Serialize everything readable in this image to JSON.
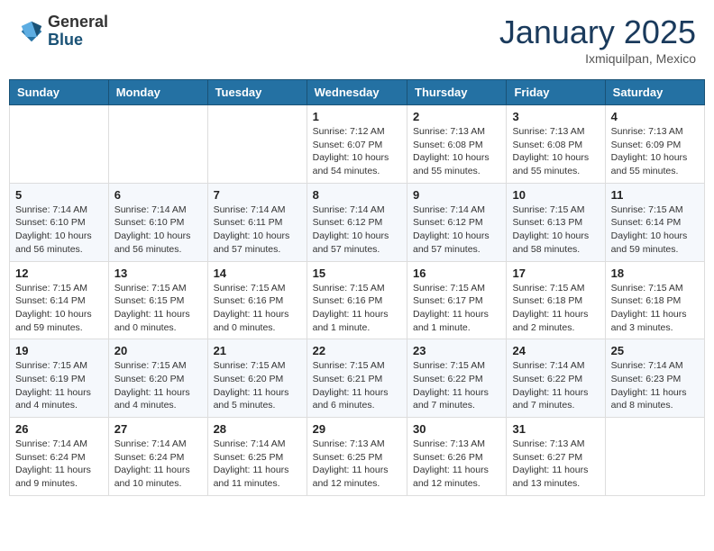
{
  "header": {
    "logo_general": "General",
    "logo_blue": "Blue",
    "month_title": "January 2025",
    "location": "Ixmiquilpan, Mexico"
  },
  "days_of_week": [
    "Sunday",
    "Monday",
    "Tuesday",
    "Wednesday",
    "Thursday",
    "Friday",
    "Saturday"
  ],
  "weeks": [
    [
      {
        "day": "",
        "info": ""
      },
      {
        "day": "",
        "info": ""
      },
      {
        "day": "",
        "info": ""
      },
      {
        "day": "1",
        "info": "Sunrise: 7:12 AM\nSunset: 6:07 PM\nDaylight: 10 hours\nand 54 minutes."
      },
      {
        "day": "2",
        "info": "Sunrise: 7:13 AM\nSunset: 6:08 PM\nDaylight: 10 hours\nand 55 minutes."
      },
      {
        "day": "3",
        "info": "Sunrise: 7:13 AM\nSunset: 6:08 PM\nDaylight: 10 hours\nand 55 minutes."
      },
      {
        "day": "4",
        "info": "Sunrise: 7:13 AM\nSunset: 6:09 PM\nDaylight: 10 hours\nand 55 minutes."
      }
    ],
    [
      {
        "day": "5",
        "info": "Sunrise: 7:14 AM\nSunset: 6:10 PM\nDaylight: 10 hours\nand 56 minutes."
      },
      {
        "day": "6",
        "info": "Sunrise: 7:14 AM\nSunset: 6:10 PM\nDaylight: 10 hours\nand 56 minutes."
      },
      {
        "day": "7",
        "info": "Sunrise: 7:14 AM\nSunset: 6:11 PM\nDaylight: 10 hours\nand 57 minutes."
      },
      {
        "day": "8",
        "info": "Sunrise: 7:14 AM\nSunset: 6:12 PM\nDaylight: 10 hours\nand 57 minutes."
      },
      {
        "day": "9",
        "info": "Sunrise: 7:14 AM\nSunset: 6:12 PM\nDaylight: 10 hours\nand 57 minutes."
      },
      {
        "day": "10",
        "info": "Sunrise: 7:15 AM\nSunset: 6:13 PM\nDaylight: 10 hours\nand 58 minutes."
      },
      {
        "day": "11",
        "info": "Sunrise: 7:15 AM\nSunset: 6:14 PM\nDaylight: 10 hours\nand 59 minutes."
      }
    ],
    [
      {
        "day": "12",
        "info": "Sunrise: 7:15 AM\nSunset: 6:14 PM\nDaylight: 10 hours\nand 59 minutes."
      },
      {
        "day": "13",
        "info": "Sunrise: 7:15 AM\nSunset: 6:15 PM\nDaylight: 11 hours\nand 0 minutes."
      },
      {
        "day": "14",
        "info": "Sunrise: 7:15 AM\nSunset: 6:16 PM\nDaylight: 11 hours\nand 0 minutes."
      },
      {
        "day": "15",
        "info": "Sunrise: 7:15 AM\nSunset: 6:16 PM\nDaylight: 11 hours\nand 1 minute."
      },
      {
        "day": "16",
        "info": "Sunrise: 7:15 AM\nSunset: 6:17 PM\nDaylight: 11 hours\nand 1 minute."
      },
      {
        "day": "17",
        "info": "Sunrise: 7:15 AM\nSunset: 6:18 PM\nDaylight: 11 hours\nand 2 minutes."
      },
      {
        "day": "18",
        "info": "Sunrise: 7:15 AM\nSunset: 6:18 PM\nDaylight: 11 hours\nand 3 minutes."
      }
    ],
    [
      {
        "day": "19",
        "info": "Sunrise: 7:15 AM\nSunset: 6:19 PM\nDaylight: 11 hours\nand 4 minutes."
      },
      {
        "day": "20",
        "info": "Sunrise: 7:15 AM\nSunset: 6:20 PM\nDaylight: 11 hours\nand 4 minutes."
      },
      {
        "day": "21",
        "info": "Sunrise: 7:15 AM\nSunset: 6:20 PM\nDaylight: 11 hours\nand 5 minutes."
      },
      {
        "day": "22",
        "info": "Sunrise: 7:15 AM\nSunset: 6:21 PM\nDaylight: 11 hours\nand 6 minutes."
      },
      {
        "day": "23",
        "info": "Sunrise: 7:15 AM\nSunset: 6:22 PM\nDaylight: 11 hours\nand 7 minutes."
      },
      {
        "day": "24",
        "info": "Sunrise: 7:14 AM\nSunset: 6:22 PM\nDaylight: 11 hours\nand 7 minutes."
      },
      {
        "day": "25",
        "info": "Sunrise: 7:14 AM\nSunset: 6:23 PM\nDaylight: 11 hours\nand 8 minutes."
      }
    ],
    [
      {
        "day": "26",
        "info": "Sunrise: 7:14 AM\nSunset: 6:24 PM\nDaylight: 11 hours\nand 9 minutes."
      },
      {
        "day": "27",
        "info": "Sunrise: 7:14 AM\nSunset: 6:24 PM\nDaylight: 11 hours\nand 10 minutes."
      },
      {
        "day": "28",
        "info": "Sunrise: 7:14 AM\nSunset: 6:25 PM\nDaylight: 11 hours\nand 11 minutes."
      },
      {
        "day": "29",
        "info": "Sunrise: 7:13 AM\nSunset: 6:25 PM\nDaylight: 11 hours\nand 12 minutes."
      },
      {
        "day": "30",
        "info": "Sunrise: 7:13 AM\nSunset: 6:26 PM\nDaylight: 11 hours\nand 12 minutes."
      },
      {
        "day": "31",
        "info": "Sunrise: 7:13 AM\nSunset: 6:27 PM\nDaylight: 11 hours\nand 13 minutes."
      },
      {
        "day": "",
        "info": ""
      }
    ]
  ]
}
